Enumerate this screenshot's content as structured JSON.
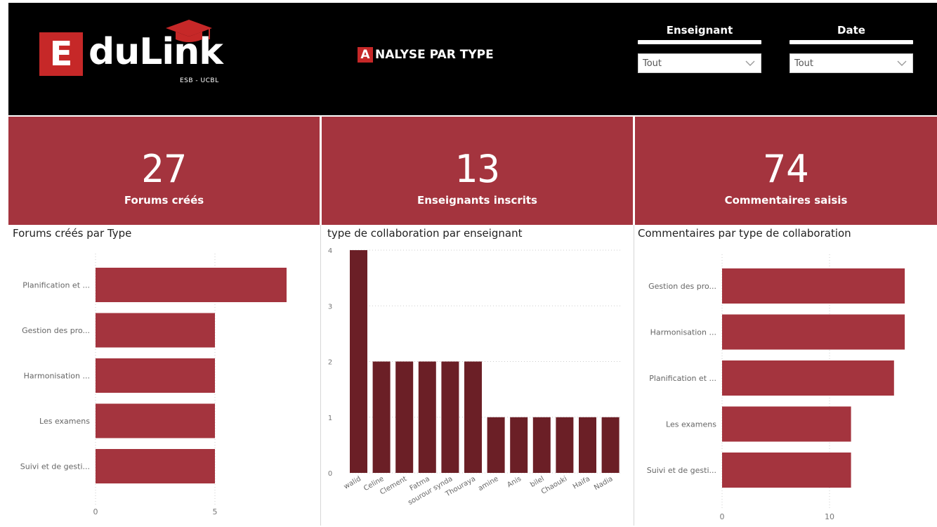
{
  "brand": {
    "logo_letter": "E",
    "logo_word": "duLink",
    "logo_sub": "ESB - UCBL",
    "logo_color": "#c62828"
  },
  "page": {
    "title_initial": "A",
    "title_rest": "NALYSE PAR TYPE"
  },
  "filters": [
    {
      "label": "Enseignant",
      "value": "Tout"
    },
    {
      "label": "Date",
      "value": "Tout"
    }
  ],
  "kpis": [
    {
      "value": "27",
      "label": "Forums créés"
    },
    {
      "value": "13",
      "label": "Enseignants inscrits"
    },
    {
      "value": "74",
      "label": "Commentaires saisis"
    }
  ],
  "colors": {
    "header_bg": "#000000",
    "kpi_bg": "#a4343e",
    "bar_light": "#a4343e",
    "bar_dark": "#6b1f26"
  },
  "chart_data": [
    {
      "type": "bar",
      "orientation": "horizontal",
      "title": "Forums créés par Type",
      "categories": [
        "Planification et ...",
        "Gestion des pro...",
        "Harmonisation ...",
        "Les examens",
        "Suivi et de gesti..."
      ],
      "values": [
        8,
        5,
        5,
        5,
        5
      ],
      "xlim": [
        0,
        8
      ],
      "xticks": [
        "0",
        "5"
      ],
      "grid": "vertical dotted"
    },
    {
      "type": "bar",
      "orientation": "vertical",
      "title": "type de collaboration par enseignant",
      "categories": [
        "walid",
        "Celine",
        "Clement",
        "Fatma",
        "sourour synda",
        "Thouraya",
        "amine",
        "Anis",
        "bilel",
        "Chaouki",
        "Haifa",
        "Nadia"
      ],
      "values": [
        4,
        2,
        2,
        2,
        2,
        2,
        1,
        1,
        1,
        1,
        1,
        1
      ],
      "ylim": [
        0,
        4
      ],
      "yticks": [
        "0",
        "1",
        "2",
        "3",
        "4"
      ],
      "grid": "horizontal dotted"
    },
    {
      "type": "bar",
      "orientation": "horizontal",
      "title": "Commentaires par type de collaboration",
      "categories": [
        "Gestion des pro...",
        "Harmonisation ...",
        "Planification et ...",
        "Les examens",
        "Suivi et de gesti..."
      ],
      "values": [
        17,
        17,
        16,
        12,
        12
      ],
      "xlim": [
        0,
        20
      ],
      "xticks": [
        "0",
        "10"
      ],
      "grid": "vertical dotted"
    }
  ]
}
